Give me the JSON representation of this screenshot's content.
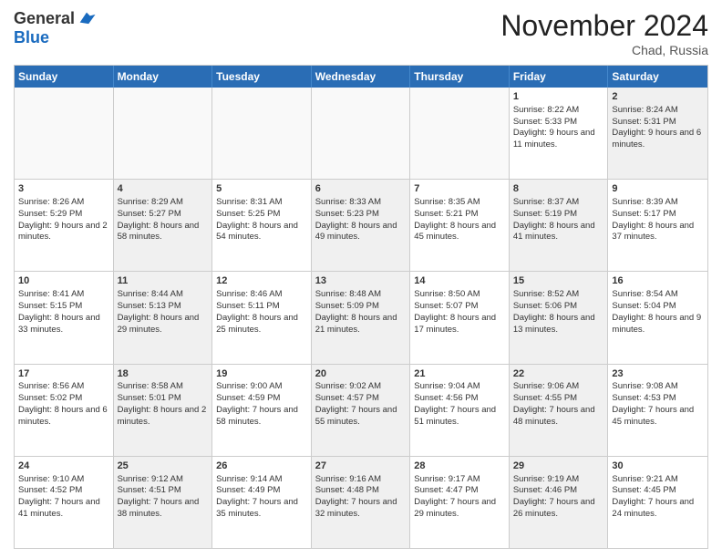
{
  "header": {
    "logo_line1": "General",
    "logo_line2": "Blue",
    "month": "November 2024",
    "location": "Chad, Russia"
  },
  "weekdays": [
    "Sunday",
    "Monday",
    "Tuesday",
    "Wednesday",
    "Thursday",
    "Friday",
    "Saturday"
  ],
  "rows": [
    [
      {
        "day": "",
        "info": "",
        "shaded": false,
        "empty": true
      },
      {
        "day": "",
        "info": "",
        "shaded": false,
        "empty": true
      },
      {
        "day": "",
        "info": "",
        "shaded": false,
        "empty": true
      },
      {
        "day": "",
        "info": "",
        "shaded": false,
        "empty": true
      },
      {
        "day": "",
        "info": "",
        "shaded": false,
        "empty": true
      },
      {
        "day": "1",
        "info": "Sunrise: 8:22 AM\nSunset: 5:33 PM\nDaylight: 9 hours and 11 minutes.",
        "shaded": false,
        "empty": false
      },
      {
        "day": "2",
        "info": "Sunrise: 8:24 AM\nSunset: 5:31 PM\nDaylight: 9 hours and 6 minutes.",
        "shaded": true,
        "empty": false
      }
    ],
    [
      {
        "day": "3",
        "info": "Sunrise: 8:26 AM\nSunset: 5:29 PM\nDaylight: 9 hours and 2 minutes.",
        "shaded": false,
        "empty": false
      },
      {
        "day": "4",
        "info": "Sunrise: 8:29 AM\nSunset: 5:27 PM\nDaylight: 8 hours and 58 minutes.",
        "shaded": true,
        "empty": false
      },
      {
        "day": "5",
        "info": "Sunrise: 8:31 AM\nSunset: 5:25 PM\nDaylight: 8 hours and 54 minutes.",
        "shaded": false,
        "empty": false
      },
      {
        "day": "6",
        "info": "Sunrise: 8:33 AM\nSunset: 5:23 PM\nDaylight: 8 hours and 49 minutes.",
        "shaded": true,
        "empty": false
      },
      {
        "day": "7",
        "info": "Sunrise: 8:35 AM\nSunset: 5:21 PM\nDaylight: 8 hours and 45 minutes.",
        "shaded": false,
        "empty": false
      },
      {
        "day": "8",
        "info": "Sunrise: 8:37 AM\nSunset: 5:19 PM\nDaylight: 8 hours and 41 minutes.",
        "shaded": true,
        "empty": false
      },
      {
        "day": "9",
        "info": "Sunrise: 8:39 AM\nSunset: 5:17 PM\nDaylight: 8 hours and 37 minutes.",
        "shaded": false,
        "empty": false
      }
    ],
    [
      {
        "day": "10",
        "info": "Sunrise: 8:41 AM\nSunset: 5:15 PM\nDaylight: 8 hours and 33 minutes.",
        "shaded": false,
        "empty": false
      },
      {
        "day": "11",
        "info": "Sunrise: 8:44 AM\nSunset: 5:13 PM\nDaylight: 8 hours and 29 minutes.",
        "shaded": true,
        "empty": false
      },
      {
        "day": "12",
        "info": "Sunrise: 8:46 AM\nSunset: 5:11 PM\nDaylight: 8 hours and 25 minutes.",
        "shaded": false,
        "empty": false
      },
      {
        "day": "13",
        "info": "Sunrise: 8:48 AM\nSunset: 5:09 PM\nDaylight: 8 hours and 21 minutes.",
        "shaded": true,
        "empty": false
      },
      {
        "day": "14",
        "info": "Sunrise: 8:50 AM\nSunset: 5:07 PM\nDaylight: 8 hours and 17 minutes.",
        "shaded": false,
        "empty": false
      },
      {
        "day": "15",
        "info": "Sunrise: 8:52 AM\nSunset: 5:06 PM\nDaylight: 8 hours and 13 minutes.",
        "shaded": true,
        "empty": false
      },
      {
        "day": "16",
        "info": "Sunrise: 8:54 AM\nSunset: 5:04 PM\nDaylight: 8 hours and 9 minutes.",
        "shaded": false,
        "empty": false
      }
    ],
    [
      {
        "day": "17",
        "info": "Sunrise: 8:56 AM\nSunset: 5:02 PM\nDaylight: 8 hours and 6 minutes.",
        "shaded": false,
        "empty": false
      },
      {
        "day": "18",
        "info": "Sunrise: 8:58 AM\nSunset: 5:01 PM\nDaylight: 8 hours and 2 minutes.",
        "shaded": true,
        "empty": false
      },
      {
        "day": "19",
        "info": "Sunrise: 9:00 AM\nSunset: 4:59 PM\nDaylight: 7 hours and 58 minutes.",
        "shaded": false,
        "empty": false
      },
      {
        "day": "20",
        "info": "Sunrise: 9:02 AM\nSunset: 4:57 PM\nDaylight: 7 hours and 55 minutes.",
        "shaded": true,
        "empty": false
      },
      {
        "day": "21",
        "info": "Sunrise: 9:04 AM\nSunset: 4:56 PM\nDaylight: 7 hours and 51 minutes.",
        "shaded": false,
        "empty": false
      },
      {
        "day": "22",
        "info": "Sunrise: 9:06 AM\nSunset: 4:55 PM\nDaylight: 7 hours and 48 minutes.",
        "shaded": true,
        "empty": false
      },
      {
        "day": "23",
        "info": "Sunrise: 9:08 AM\nSunset: 4:53 PM\nDaylight: 7 hours and 45 minutes.",
        "shaded": false,
        "empty": false
      }
    ],
    [
      {
        "day": "24",
        "info": "Sunrise: 9:10 AM\nSunset: 4:52 PM\nDaylight: 7 hours and 41 minutes.",
        "shaded": false,
        "empty": false
      },
      {
        "day": "25",
        "info": "Sunrise: 9:12 AM\nSunset: 4:51 PM\nDaylight: 7 hours and 38 minutes.",
        "shaded": true,
        "empty": false
      },
      {
        "day": "26",
        "info": "Sunrise: 9:14 AM\nSunset: 4:49 PM\nDaylight: 7 hours and 35 minutes.",
        "shaded": false,
        "empty": false
      },
      {
        "day": "27",
        "info": "Sunrise: 9:16 AM\nSunset: 4:48 PM\nDaylight: 7 hours and 32 minutes.",
        "shaded": true,
        "empty": false
      },
      {
        "day": "28",
        "info": "Sunrise: 9:17 AM\nSunset: 4:47 PM\nDaylight: 7 hours and 29 minutes.",
        "shaded": false,
        "empty": false
      },
      {
        "day": "29",
        "info": "Sunrise: 9:19 AM\nSunset: 4:46 PM\nDaylight: 7 hours and 26 minutes.",
        "shaded": true,
        "empty": false
      },
      {
        "day": "30",
        "info": "Sunrise: 9:21 AM\nSunset: 4:45 PM\nDaylight: 7 hours and 24 minutes.",
        "shaded": false,
        "empty": false
      }
    ]
  ]
}
